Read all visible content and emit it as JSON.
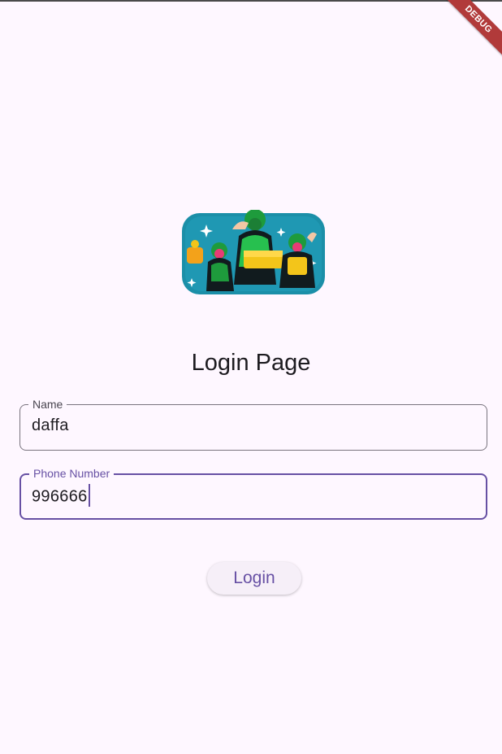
{
  "debug_banner": "DEBUG",
  "illustration": {
    "icon": "delivery-riders-illustration",
    "colors": {
      "background": "#1b8fa8",
      "green": "#1e9b3c",
      "yellow": "#f3c51a"
    }
  },
  "page": {
    "title": "Login Page"
  },
  "form": {
    "name": {
      "label": "Name",
      "value": "daffa"
    },
    "phone": {
      "label": "Phone Number",
      "value": "996666"
    }
  },
  "login_button": {
    "label": "Login"
  },
  "colors": {
    "accent": "#6750a4",
    "background": "#fef7ff",
    "outline": "#79747e"
  }
}
